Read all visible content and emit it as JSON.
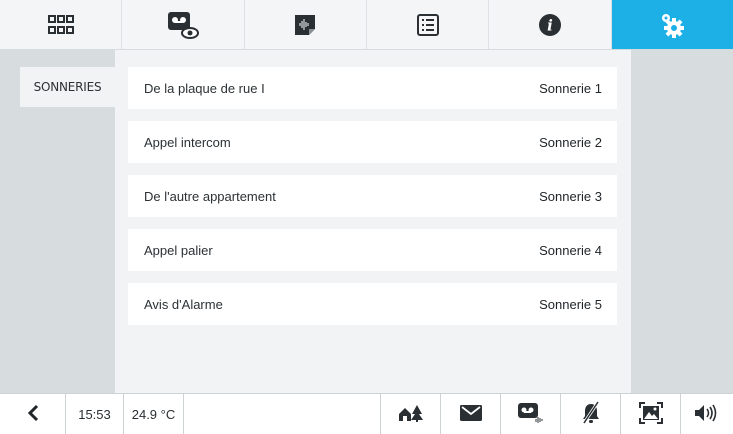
{
  "tabs": [
    {
      "icon": "apps-grid-icon",
      "active": false
    },
    {
      "icon": "video-message-icon",
      "active": false
    },
    {
      "icon": "voice-memo-icon",
      "active": false
    },
    {
      "icon": "list-icon",
      "active": false
    },
    {
      "icon": "info-icon",
      "active": false
    },
    {
      "icon": "settings-gears-icon",
      "active": true
    }
  ],
  "sidebar": {
    "items": [
      {
        "label": "SONNERIES"
      }
    ]
  },
  "ringtones": [
    {
      "label": "De la plaque de rue I",
      "value": "Sonnerie 1"
    },
    {
      "label": "Appel intercom",
      "value": "Sonnerie 2"
    },
    {
      "label": "De l'autre appartement",
      "value": "Sonnerie 3"
    },
    {
      "label": "Appel palier",
      "value": "Sonnerie 4"
    },
    {
      "label": "Avis d'Alarme",
      "value": "Sonnerie 5"
    }
  ],
  "status": {
    "time": "15:53",
    "temperature": "24.9 °C",
    "icons": [
      "back-chevron-icon",
      "home-away-icon",
      "mail-icon",
      "answering-machine-icon",
      "do-not-disturb-icon",
      "screen-icon",
      "volume-icon"
    ]
  },
  "colors": {
    "accent": "#1db0e6",
    "panel": "#d7dcdf",
    "background": "#f2f3f4"
  }
}
